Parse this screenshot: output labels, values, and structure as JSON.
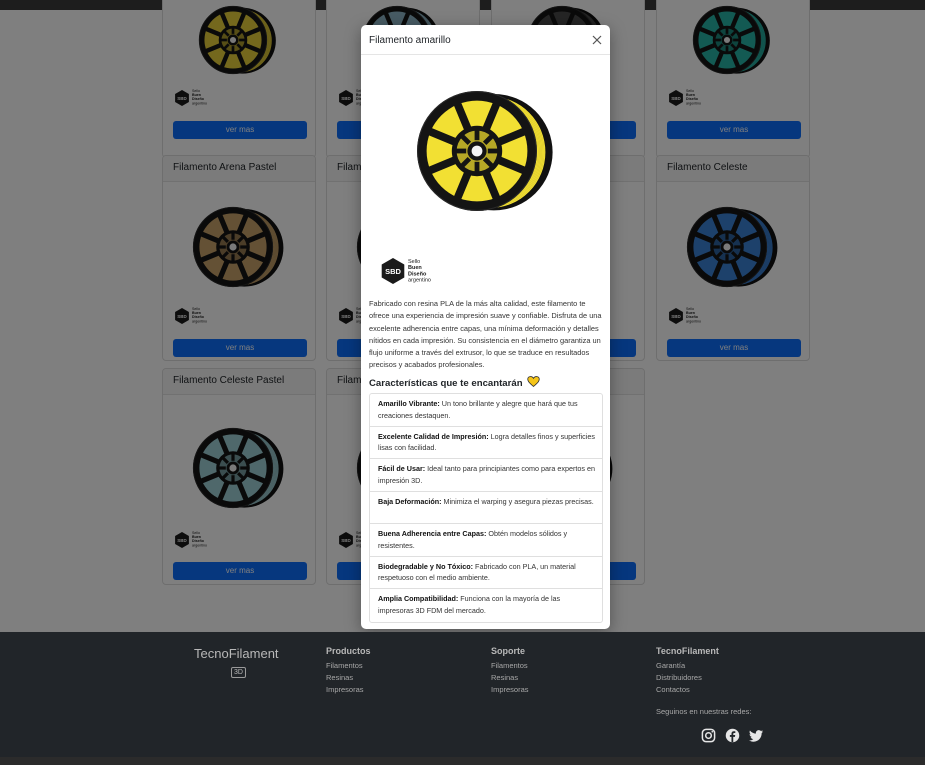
{
  "cards": [
    {
      "title": "",
      "button": "ver mas",
      "color": "#e8d13a"
    },
    {
      "title": "",
      "button": "ver mas",
      "color": "#8fb7c8"
    },
    {
      "title": "",
      "button": "ver mas",
      "color": "#4a4a4a"
    },
    {
      "title": "",
      "button": "ver mas",
      "color": "#27b5a7"
    },
    {
      "title": "Filamento Arena Pastel",
      "button": "ver mas",
      "color": "#c9a36a"
    },
    {
      "title": "Filame",
      "button": "ver mas",
      "color": "#cccccc"
    },
    {
      "title": "",
      "button": "ver mas",
      "color": "#cccccc"
    },
    {
      "title": "Filamento Celeste",
      "button": "ver mas",
      "color": "#3b82d6"
    },
    {
      "title": "Filamento Celeste Pastel",
      "button": "ver mas",
      "color": "#9fd0d6"
    },
    {
      "title": "Filame",
      "button": "ver mas",
      "color": "#cccccc"
    },
    {
      "title": "",
      "button": "ver mas",
      "color": "#222222"
    }
  ],
  "seal": {
    "line1": "Sello",
    "line2": "Buen",
    "line3": "Diseño",
    "line4": "argentino",
    "abbr": "SBD"
  },
  "modal": {
    "title": "Filamento amarillo",
    "spool_color": "#f2e033",
    "description": "Fabricado con resina PLA de la más alta calidad, este filamento te ofrece una experiencia de impresión suave y confiable. Disfruta de una excelente adherencia entre capas, una mínima deformación y detalles nítidos en cada impresión. Su consistencia en el diámetro garantiza un flujo uniforme a través del extrusor, lo que se traduce en resultados precisos y acabados profesionales.",
    "features_title": "Características que te encantarán",
    "heart_color": "#f5c518",
    "features": [
      {
        "name": "Amarillo Vibrante:",
        "text": " Un tono brillante y alegre que hará que tus creaciones destaquen."
      },
      {
        "name": "Excelente Calidad de Impresión:",
        "text": " Logra detalles finos y superficies lisas con facilidad."
      },
      {
        "name": "Fácil de Usar:",
        "text": " Ideal tanto para principiantes como para expertos en impresión 3D."
      },
      {
        "name": "Baja Deformación:",
        "text": " Minimiza el warping y asegura piezas precisas."
      },
      {
        "name": "Buena Adherencia entre Capas:",
        "text": " Obtén modelos sólidos y resistentes."
      },
      {
        "name": "Biodegradable y No Tóxico:",
        "text": " Fabricado con PLA, un material respetuoso con el medio ambiente."
      },
      {
        "name": "Amplia Compatibilidad:",
        "text": " Funciona con la mayoría de las impresoras 3D FDM del mercado."
      }
    ]
  },
  "footer": {
    "brand": "TecnoFilament",
    "badge": "3D",
    "columns": [
      {
        "title": "Productos",
        "links": [
          "Filamentos",
          "Resinas",
          "Impresoras"
        ]
      },
      {
        "title": "Soporte",
        "links": [
          "Filamentos",
          "Resinas",
          "Impresoras"
        ]
      },
      {
        "title": "TecnoFilament",
        "links": [
          "Garantía",
          "Distribuidores",
          "Contactos"
        ]
      }
    ],
    "follow": "Seguinos en nuestras redes:",
    "social": [
      "instagram-icon",
      "facebook-icon",
      "twitter-icon"
    ]
  }
}
